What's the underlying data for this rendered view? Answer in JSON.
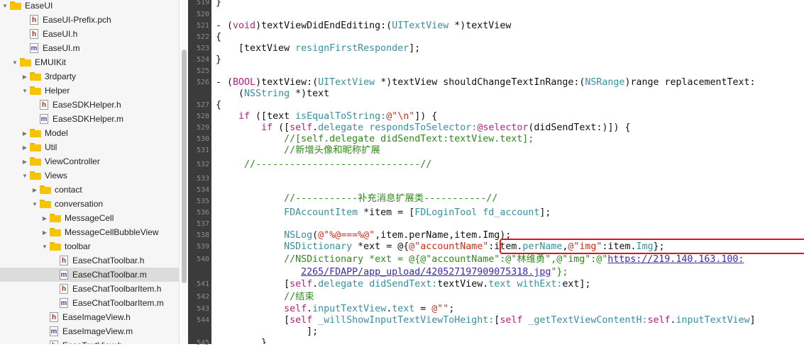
{
  "sidebar": {
    "items": [
      {
        "label": "EaseUI",
        "kind": "folder",
        "arrow": "▼"
      },
      {
        "label": "EaseUI-Prefix.pch",
        "kind": "h"
      },
      {
        "label": "EaseUI.h",
        "kind": "h"
      },
      {
        "label": "EaseUI.m",
        "kind": "m"
      },
      {
        "label": "EMUIKit",
        "kind": "folder",
        "arrow": "▼"
      },
      {
        "label": "3rdparty",
        "kind": "folder",
        "arrow": "▶"
      },
      {
        "label": "Helper",
        "kind": "folder",
        "arrow": "▼"
      },
      {
        "label": "EaseSDKHelper.h",
        "kind": "h"
      },
      {
        "label": "EaseSDKHelper.m",
        "kind": "m"
      },
      {
        "label": "Model",
        "kind": "folder",
        "arrow": "▶"
      },
      {
        "label": "Util",
        "kind": "folder",
        "arrow": "▶"
      },
      {
        "label": "ViewController",
        "kind": "folder",
        "arrow": "▶"
      },
      {
        "label": "Views",
        "kind": "folder",
        "arrow": "▼"
      },
      {
        "label": "contact",
        "kind": "folder",
        "arrow": "▶"
      },
      {
        "label": "conversation",
        "kind": "folder",
        "arrow": "▼"
      },
      {
        "label": "MessageCell",
        "kind": "folder",
        "arrow": "▶"
      },
      {
        "label": "MessageCellBubbleView",
        "kind": "folder",
        "arrow": "▶"
      },
      {
        "label": "toolbar",
        "kind": "folder",
        "arrow": "▼"
      },
      {
        "label": "EaseChatToolbar.h",
        "kind": "h"
      },
      {
        "label": "EaseChatToolbar.m",
        "kind": "m",
        "selected": true
      },
      {
        "label": "EaseChatToolbarItem.h",
        "kind": "h"
      },
      {
        "label": "EaseChatToolbarItem.m",
        "kind": "m"
      },
      {
        "label": "EaseImageView.h",
        "kind": "h"
      },
      {
        "label": "EaseImageView.m",
        "kind": "m"
      },
      {
        "label": "EaseTextView.h",
        "kind": "h"
      }
    ]
  },
  "gutter": {
    "lines": [
      "519",
      "520",
      "521",
      "522",
      "523",
      "524",
      "525",
      "526",
      "",
      "527",
      "528",
      "529",
      "530",
      "531",
      "532",
      "533",
      "534",
      "535",
      "536",
      "537",
      "538",
      "539",
      "540",
      "",
      "541",
      "542",
      "543",
      "544",
      "",
      "545"
    ]
  },
  "code": {
    "l519": "}",
    "l521_a": "- (",
    "l521_void": "void",
    "l521_b": ")textViewDidEndEditing:(",
    "l521_type": "UITextView",
    "l521_c": " *)textView",
    "l522": "{",
    "l523_a": "    [textView ",
    "l523_method": "resignFirstResponder",
    "l523_b": "];",
    "l524": "}",
    "l526_a": "- (",
    "l526_bool": "BOOL",
    "l526_b": ")textView:(",
    "l526_type": "UITextView",
    "l526_c": " *)textView shouldChangeTextInRange:(",
    "l526_range": "NSRange",
    "l526_d": ")range replacementText:",
    "l526w_a": "    (",
    "l526w_type": "NSString",
    "l526w_b": " *)text",
    "l527": "{",
    "l528_a": "    ",
    "l528_if": "if",
    "l528_b": " ([text ",
    "l528_m": "isEqualToString:",
    "l528_str": "@\"\\n\"",
    "l528_c": "]) {",
    "l529_a": "        ",
    "l529_if": "if",
    "l529_b": " ([",
    "l529_self": "self",
    "l529_c": ".",
    "l529_del": "delegate",
    "l529_d": " ",
    "l529_m": "respondsToSelector:",
    "l529_sel": "@selector",
    "l529_e": "(didSendText:)]) {",
    "l530": "            //[self.delegate didSendText:textView.text];",
    "l531": "            //新增头像和昵称扩展",
    "l532": "     //-----------------------------//",
    "l535": "            //-----------补充消息扩展类-----------//",
    "l536_a": "            ",
    "l536_type": "FDAccountItem",
    "l536_b": " *item = [",
    "l536_cls": "FDLoginTool",
    "l536_c": " ",
    "l536_m": "fd_account",
    "l536_d": "];",
    "l538_a": "            ",
    "l538_m": "NSLog",
    "l538_b": "(",
    "l538_str": "@\"%@===%@\"",
    "l538_c": ",item.perName,item.Img);",
    "l539_a": "            ",
    "l539_type": "NSDictionary",
    "l539_b": " *ext = @{",
    "l539_s1": "@\"accountName\"",
    "l539_c": ":item.",
    "l539_p1": "perName",
    "l539_d": ",",
    "l539_s2": "@\"img\"",
    "l539_e": ":item.",
    "l539_p2": "Img",
    "l539_f": "};",
    "l540_a": "            //NSDictionary *ext = @{@\"accountName\":@\"林维勇\",@\"img\":@\"",
    "l540_link": "https://219.140.163.100:",
    "l540w_a": "               ",
    "l540w_link": "2265/FDAPP/app_upload/420527197909075318.jpg",
    "l540w_b": "\"};",
    "l541_a": "            [",
    "l541_self": "self",
    "l541_b": ".",
    "l541_del": "delegate",
    "l541_c": " ",
    "l541_m": "didSendText:",
    "l541_d": "textView.",
    "l541_p": "text",
    "l541_e": " ",
    "l541_m2": "withExt:",
    "l541_f": "ext];",
    "l542": "            //结束",
    "l543_a": "            ",
    "l543_self": "self",
    "l543_b": ".",
    "l543_p": "inputTextView",
    "l543_c": ".",
    "l543_p2": "text",
    "l543_d": " = ",
    "l543_str": "@\"\"",
    "l543_e": ";",
    "l544_a": "            [",
    "l544_self": "self",
    "l544_b": " ",
    "l544_m": "_willShowInputTextViewToHeight:",
    "l544_c": "[",
    "l544_self2": "self",
    "l544_d": " ",
    "l544_m2": "_getTextViewContentH:",
    "l544_self3": "self",
    "l544_e": ".",
    "l544_p": "inputTextView",
    "l544_f": "]",
    "l544w": "                ];",
    "l545": "        }"
  }
}
